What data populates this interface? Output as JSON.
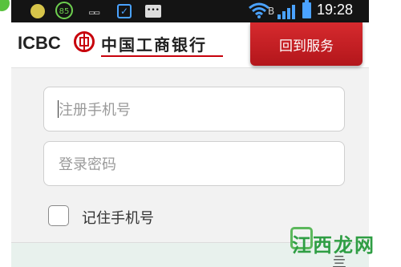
{
  "statusbar": {
    "battery_indicator": "85",
    "network_label": "B",
    "time": "19:28",
    "icons": [
      "app-dot-icon",
      "battery-circle-icon",
      "keyboard-icon",
      "check-icon",
      "message-icon",
      "wifi-icon",
      "signal-icon",
      "battery-icon"
    ]
  },
  "header": {
    "logo_text": "ICBC",
    "bank_name": "中国工商银行",
    "back_button_label": "回到服务"
  },
  "form": {
    "phone_placeholder": "注册手机号",
    "phone_value": "",
    "password_placeholder": "登录密码",
    "password_value": "",
    "remember_label": "记住手机号",
    "remember_checked": false
  },
  "bottom": {
    "glyph": "亖"
  },
  "watermark": {
    "text": "江西龙网"
  },
  "colors": {
    "brand_red": "#c7000b",
    "button_red": "#c8201f",
    "page_bg": "#f2f2f2",
    "statusbar_bg": "#141414",
    "accent_blue": "#4aa2ff",
    "accent_green": "#6ed04f"
  }
}
